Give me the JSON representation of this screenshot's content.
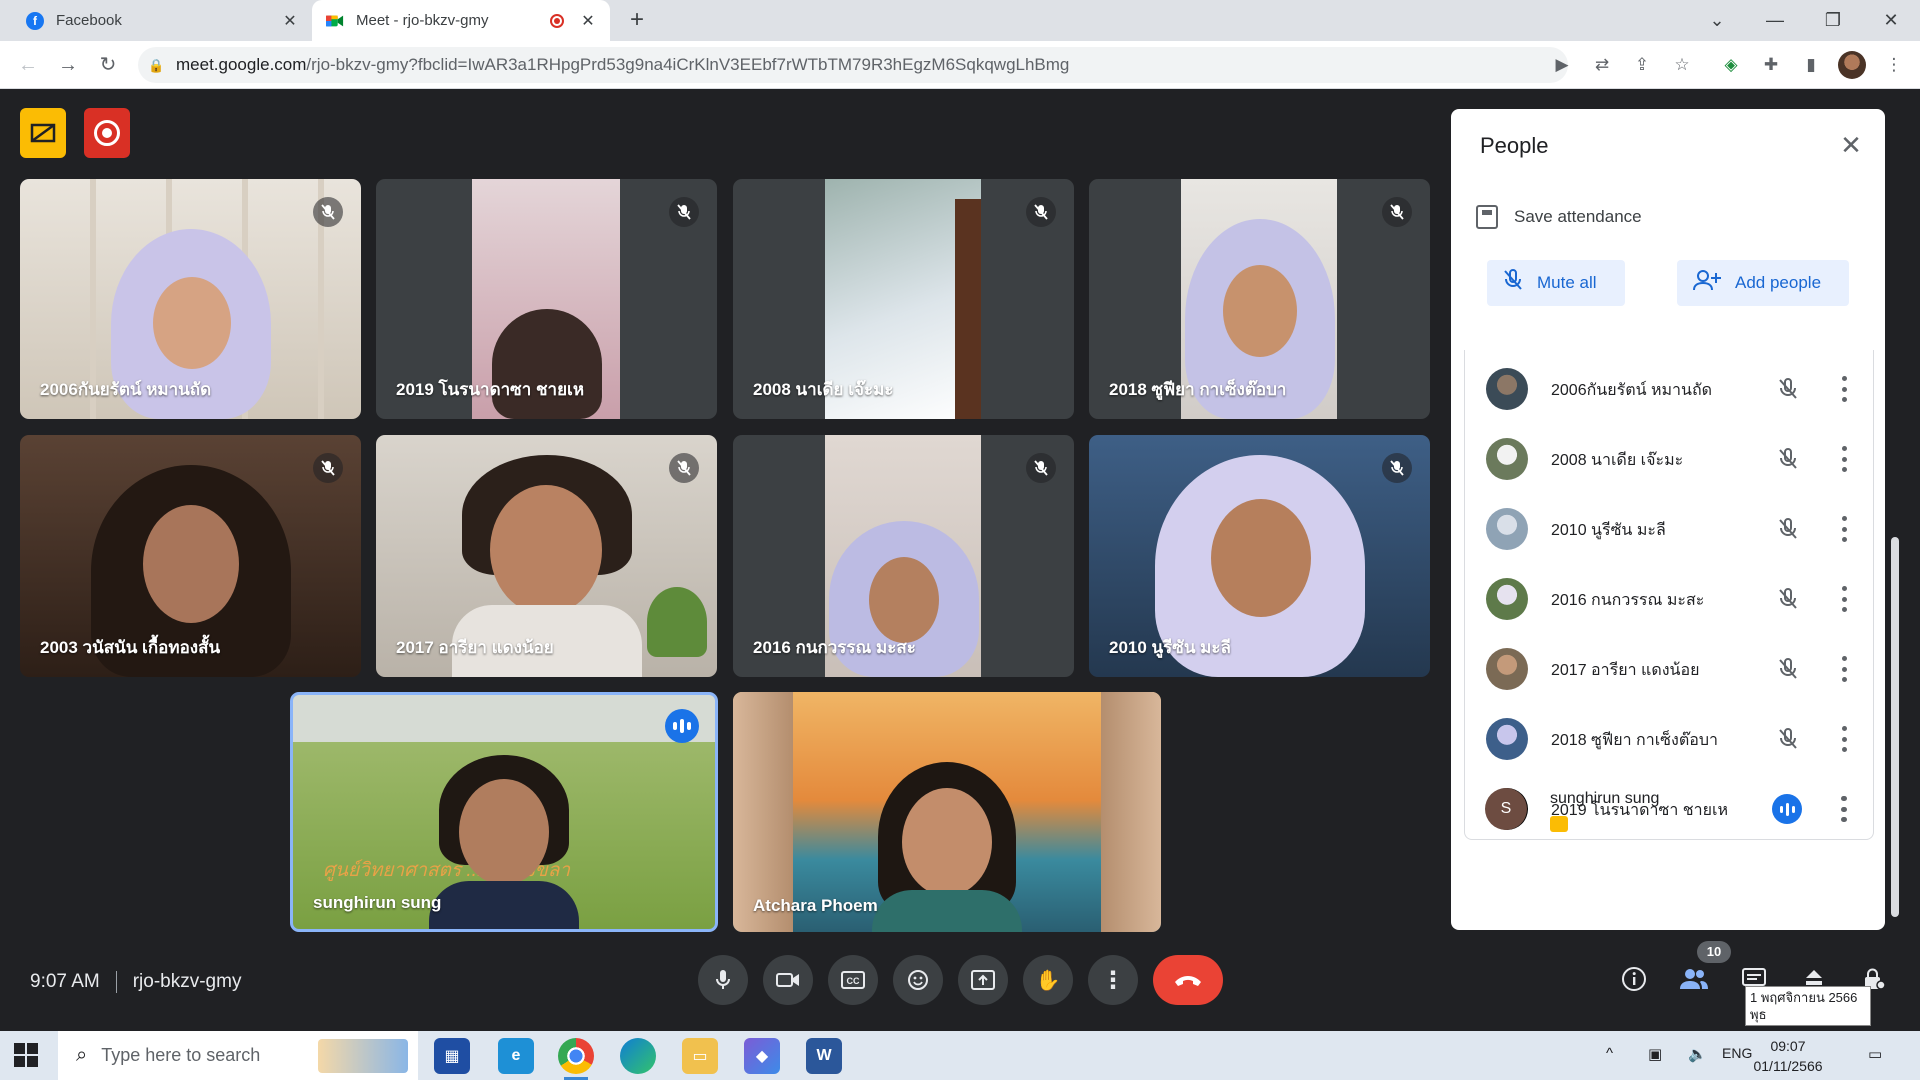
{
  "browser": {
    "tabs": [
      {
        "title": "Facebook",
        "favicon": "facebook-icon",
        "color": "#1877f2"
      },
      {
        "title": "Meet - rjo-bkzv-gmy",
        "favicon": "meet-icon",
        "recording": true
      }
    ],
    "url_host": "meet.google.com",
    "url_path": "/rjo-bkzv-gmy?fbclid=IwAR3a1RHpgPrd53g9na4iCrKlnV3EEbf7rWTbTM79R3hEgzM6SqkqwgLhBmg"
  },
  "meet": {
    "tiles": [
      {
        "name": "2006กันยรัตน์ หมานถัด",
        "muted": true
      },
      {
        "name": "2019 โนรนาดาซา ชายเห",
        "muted": true
      },
      {
        "name": "2008 นาเดีย เจ๊ะมะ",
        "muted": true
      },
      {
        "name": "2018 ซูฟียา กาเซ็งต๊อบา",
        "muted": true
      },
      {
        "name": "2003 วนัสนัน เกื้อทองสั้น",
        "muted": true
      },
      {
        "name": "2017 อารียา แดงน้อย",
        "muted": true
      },
      {
        "name": "2016 กนกวรรณ มะสะ",
        "muted": true
      },
      {
        "name": "2010 นูรีซัน มะลี",
        "muted": true
      },
      {
        "name": "sunghirun sung",
        "muted": false,
        "speaking": true
      },
      {
        "name": "Atchara Phoem",
        "muted": false
      },
      {
        "overlay_text": "ศูนย์วิทยาศาสตร์ ... 12 สงขลา"
      }
    ],
    "time": "9:07 AM",
    "meeting_code": "rjo-bkzv-gmy",
    "participant_count": "10",
    "tooltip_date": "1 พฤศจิกายน 2566",
    "tooltip_day": "พุธ"
  },
  "people_panel": {
    "title": "People",
    "save_attendance": "Save attendance",
    "mute_all": "Mute all",
    "add_people": "Add people",
    "participants": [
      {
        "name": "2006กันยรัตน์ หมานถัด",
        "muted": true
      },
      {
        "name": "2008 นาเดีย เจ๊ะมะ",
        "muted": true
      },
      {
        "name": "2010 นูรีซัน มะลี",
        "muted": true
      },
      {
        "name": "2016 กนกวรรณ มะสะ",
        "muted": true
      },
      {
        "name": "2017 อารียา แดงน้อย",
        "muted": true
      },
      {
        "name": "2018 ซูฟียา กาเซ็งต๊อบา",
        "muted": true
      },
      {
        "name": "2019 โนรนาดาซา ชายเห",
        "muted": true
      },
      {
        "name": "sunghirun sung",
        "muted": false,
        "avatar_letter": "S"
      }
    ]
  },
  "taskbar": {
    "search_placeholder": "Type here to search",
    "language": "ENG",
    "time": "09:07",
    "date": "01/11/2566"
  },
  "colors": {
    "meet_bg": "#202124",
    "accent_blue": "#1a73e8",
    "hangup_red": "#ea4335",
    "recording_red": "#d93025",
    "badge_yellow": "#fbbc04"
  }
}
